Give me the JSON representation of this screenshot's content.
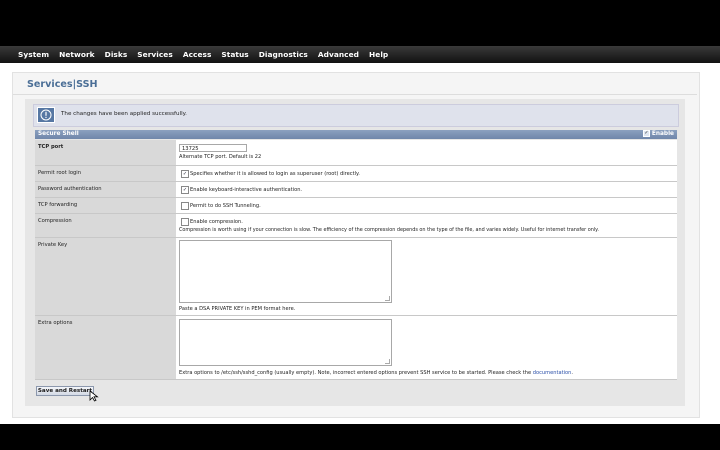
{
  "nav": {
    "items": [
      "System",
      "Network",
      "Disks",
      "Services",
      "Access",
      "Status",
      "Diagnostics",
      "Advanced",
      "Help"
    ]
  },
  "page": {
    "title": "Services|SSH",
    "notice": "The changes have been applied successfully."
  },
  "section": {
    "title": "Secure Shell",
    "enable_label": "Enable",
    "enable_checked": true
  },
  "fields": {
    "tcp_port": {
      "label": "TCP port",
      "value": "13725",
      "hint": "Alternate TCP port. Default is 22"
    },
    "permit_root": {
      "label": "Permit root login",
      "checked": true,
      "text": "Specifies whether it is allowed to login as superuser (root) directly."
    },
    "password_auth": {
      "label": "Password authentication",
      "checked": true,
      "text": "Enable keyboard-interactive authentication."
    },
    "tcp_forwarding": {
      "label": "TCP forwarding",
      "checked": false,
      "text": "Permit to do SSH Tunneling."
    },
    "compression": {
      "label": "Compression",
      "checked": false,
      "text": "Enable compression.",
      "hint": "Compression is worth using if your connection is slow. The efficiency of the compression depends on the type of the file, and varies widely. Useful for internet transfer only."
    },
    "private_key": {
      "label": "Private Key",
      "value": "",
      "hint": "Paste a DSA PRIVATE KEY in PEM format here."
    },
    "extra_options": {
      "label": "Extra options",
      "value": "",
      "hint": "Extra options to /etc/ssh/sshd_config (usually empty). Note, incorrect entered options prevent SSH service to be started. Please check the",
      "link": "documentation",
      "hint_end": "."
    }
  },
  "actions": {
    "save_label": "Save and Restart"
  },
  "colors": {
    "title": "#4a6e96",
    "section_header": "#7a90b4",
    "link": "#2a4fa8"
  }
}
